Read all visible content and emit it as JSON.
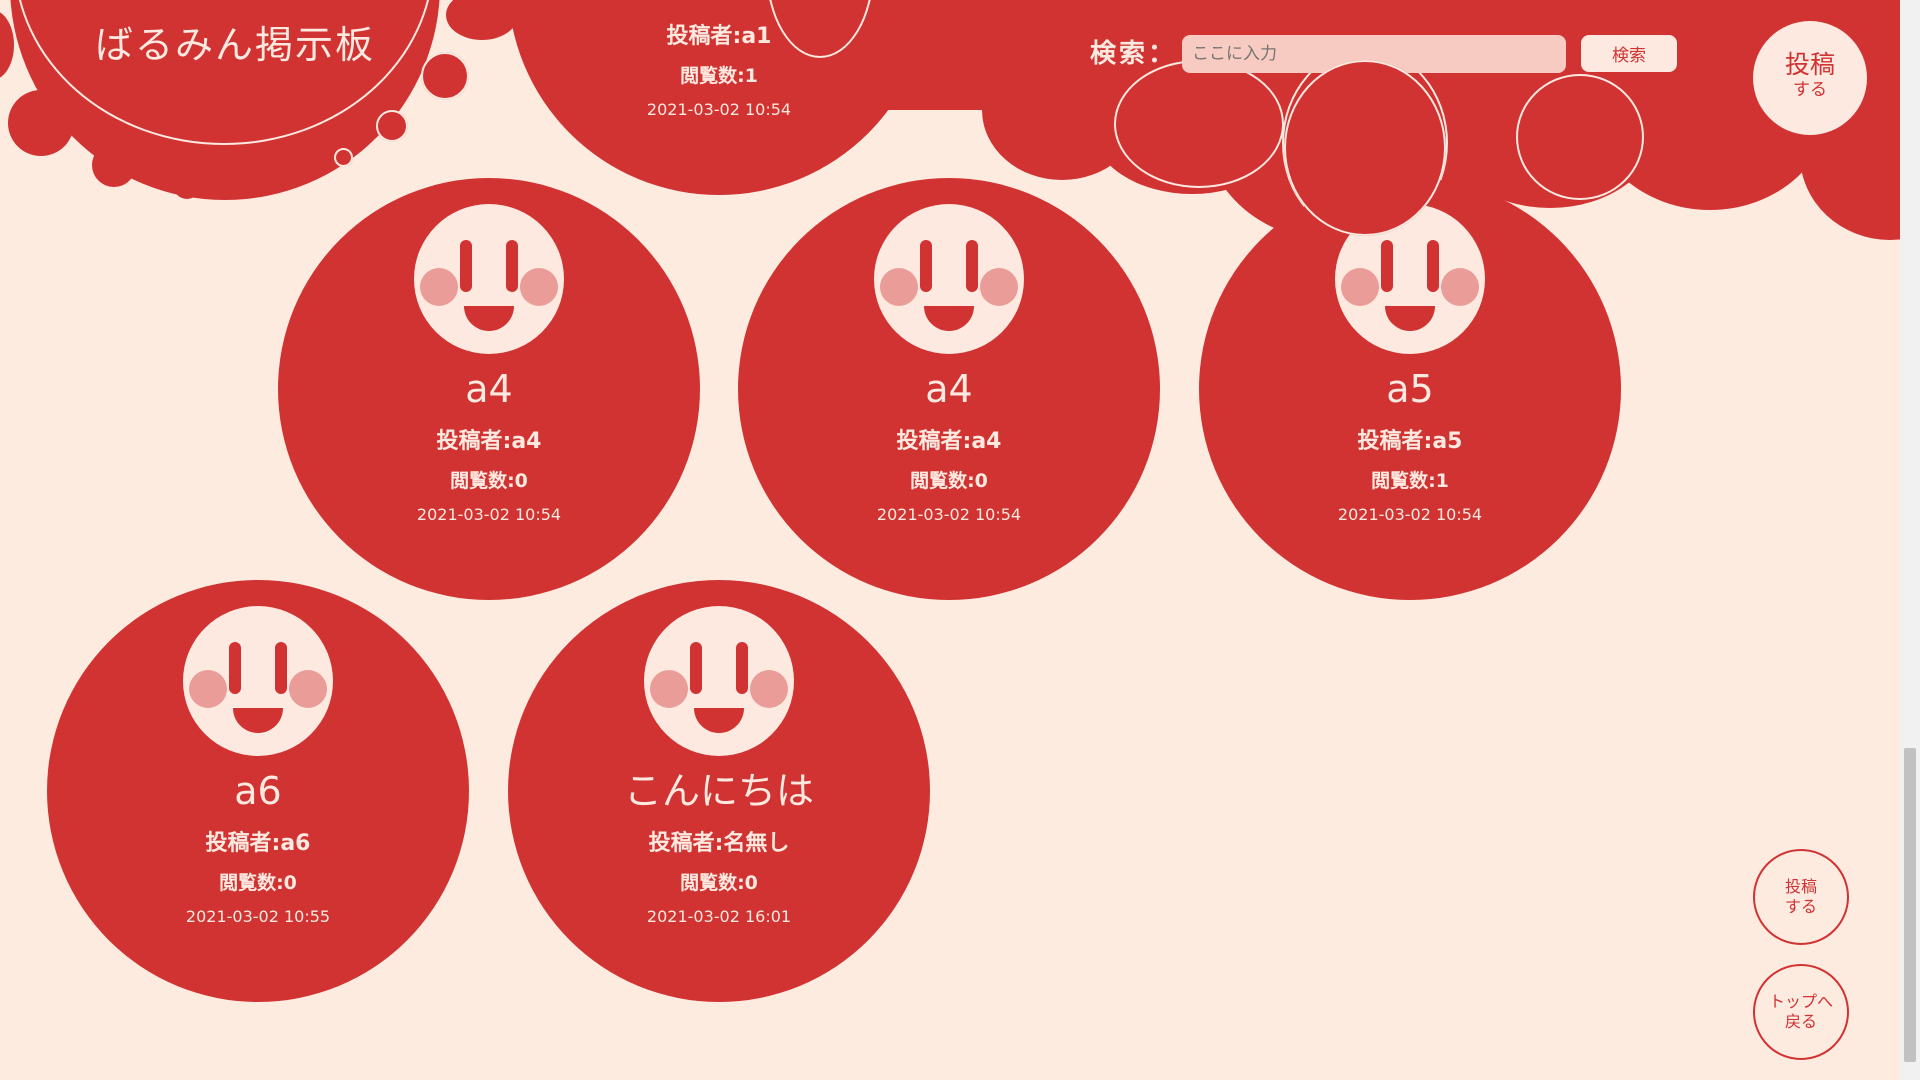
{
  "header": {
    "site_title": "ばるみん掲示板",
    "search_label": "検索：",
    "search_placeholder": "ここに入力",
    "search_button": "検索",
    "post_button_line1": "投稿",
    "post_button_line2": "する"
  },
  "partial_post": {
    "author": "投稿者:a1",
    "views": "閲覧数:1",
    "date": "2021-03-02 10:54"
  },
  "posts": [
    {
      "title": "a4",
      "author": "投稿者:a4",
      "views": "閲覧数:0",
      "date": "2021-03-02 10:54"
    },
    {
      "title": "a4",
      "author": "投稿者:a4",
      "views": "閲覧数:0",
      "date": "2021-03-02 10:54"
    },
    {
      "title": "a5",
      "author": "投稿者:a5",
      "views": "閲覧数:1",
      "date": "2021-03-02 10:54"
    },
    {
      "title": "a6",
      "author": "投稿者:a6",
      "views": "閲覧数:0",
      "date": "2021-03-02 10:55"
    },
    {
      "title": "こんにちは",
      "author": "投稿者:名無し",
      "views": "閲覧数:0",
      "date": "2021-03-02 16:01"
    }
  ],
  "side_buttons": {
    "post_line1": "投稿",
    "post_line2": "する",
    "top_line1": "トップへ",
    "top_line2": "戻る"
  },
  "colors": {
    "background": "#fdebe0",
    "accent_red": "#d13232",
    "cream": "#fde9df",
    "cheek_pink": "#ea9c98"
  }
}
